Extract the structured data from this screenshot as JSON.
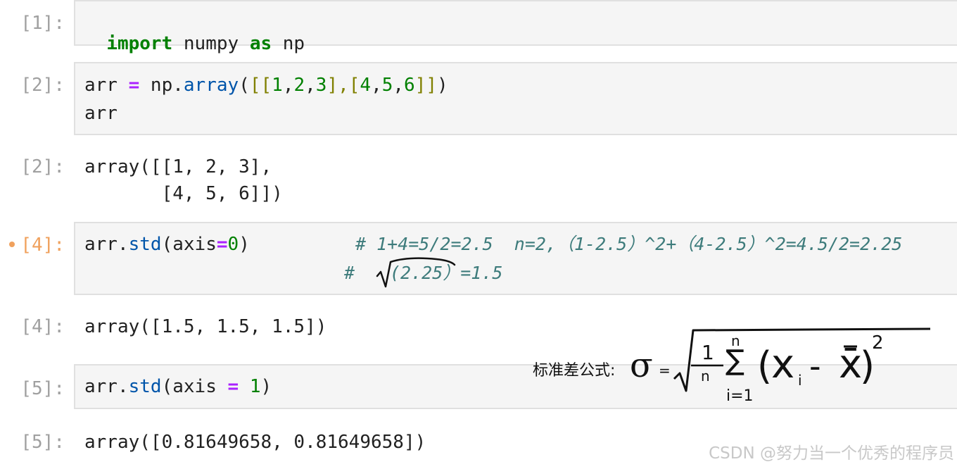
{
  "cells": [
    {
      "prompt": "[1]:",
      "code_lines": [
        {
          "kw_import": "import",
          "mod": " numpy ",
          "kw_as": "as",
          "alias": " np"
        }
      ]
    },
    {
      "prompt": "[2]:",
      "code_lines": [
        {
          "text_a": "arr ",
          "op": "=",
          "text_b": " np.",
          "attr": "array",
          "open": "(",
          "br1": "[[",
          "n1": "1",
          "c1": ",",
          "n2": "2",
          "c2": ",",
          "n3": "3",
          "br2": "],[",
          "n4": "4",
          "c3": ",",
          "n5": "5",
          "c4": ",",
          "n6": "6",
          "br3": "]]",
          "close": ")"
        },
        {
          "text": "arr"
        }
      ],
      "output_prompt": "[2]:",
      "output_lines": [
        "array([[1, 2, 3],",
        "       [4, 5, 6]])"
      ]
    },
    {
      "prompt": "[4]:",
      "code_lines": [
        {
          "text_a": "arr.",
          "attr": "std",
          "open": "(axis",
          "op": "=",
          "num": "0",
          "close": ")",
          "comment": "# 1+4=5/2=2.5  n=2,（1-2.5）^2+（4-2.5）^2=4.5/2=2.25"
        },
        {
          "comment_hash": "#",
          "comment_rest": "(2.25）=1.5"
        }
      ],
      "output_prompt": "[4]:",
      "output_lines": [
        "array([1.5, 1.5, 1.5])"
      ]
    },
    {
      "prompt": "[5]:",
      "code_lines": [
        {
          "text_a": "arr.",
          "attr": "std",
          "open": "(axis ",
          "op": "=",
          "num": " 1",
          "close": ")"
        }
      ],
      "output_prompt": "[5]:",
      "output_lines": [
        "array([0.81649658, 0.81649658])"
      ]
    }
  ],
  "formula": {
    "label": "标准差公式:",
    "sigma": "σ",
    "equals": "=",
    "one": "1",
    "n_bottom": "n",
    "n_top": "n",
    "sum": "∑",
    "i_eq_1": "i=1",
    "open_paren": "(",
    "x": "x",
    "sub_i": "i",
    "minus": "-",
    "x_bar": "x̄",
    "close_paren": ")",
    "power": "2"
  },
  "watermark": "CSDN @努力当一个优秀的程序员",
  "colors": {
    "prompt": "#a0a0a0",
    "prompt_active": "#f0a15d",
    "keyword": "#008000",
    "operator": "#aa22ff",
    "attribute": "#0055aa",
    "comment": "#3d7b7b",
    "cell_bg": "#f5f5f5"
  }
}
